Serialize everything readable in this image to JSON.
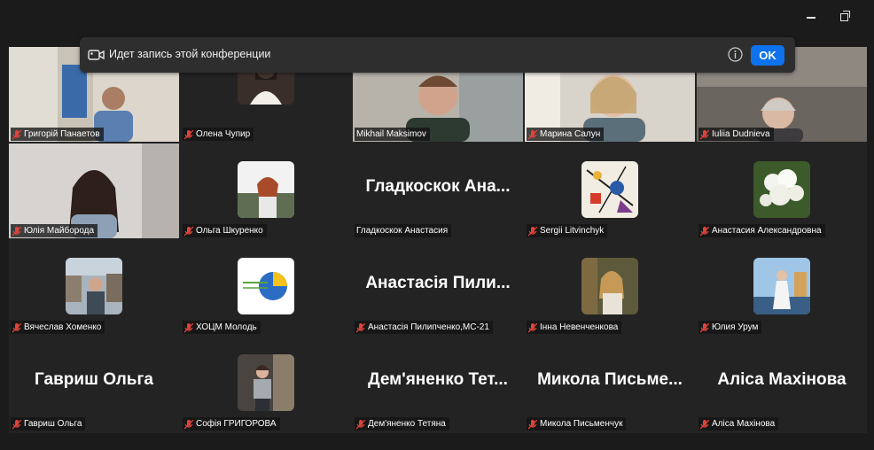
{
  "banner": {
    "text": "Идет запись этой конференции",
    "ok_label": "OK"
  },
  "window_controls": [
    "minimize-icon",
    "restore-icon"
  ],
  "participants": [
    {
      "name": "Григорій Панаетов",
      "muted": true
    },
    {
      "name": "Олена Чупир",
      "muted": true
    },
    {
      "name": "Mikhail Maksimov",
      "muted": false,
      "active_speaker": true
    },
    {
      "name": "Марина Салун",
      "muted": true
    },
    {
      "name": "Iuliia Dudnieva",
      "muted": true
    },
    {
      "name": "Юлія Майборода",
      "muted": true
    },
    {
      "name": "Ольга Шкуренко",
      "muted": true
    },
    {
      "name": "Гладкоскок Анастасия",
      "muted": false,
      "display_name": "Гладкоскок  Ана..."
    },
    {
      "name": "Sergii Litvinchyk",
      "muted": true
    },
    {
      "name": "Анастасия Александровна",
      "muted": true
    },
    {
      "name": "Вячеслав Хоменко",
      "muted": true
    },
    {
      "name": "ХОЦМ Молодь",
      "muted": true
    },
    {
      "name": "Анастасія Пилипченко,МС-21",
      "muted": true,
      "display_name": "Анастасія  Пили..."
    },
    {
      "name": "Інна Невенченкова",
      "muted": true
    },
    {
      "name": "Юлия Урум",
      "muted": true
    },
    {
      "name": "Гавриш Ольга",
      "muted": true,
      "display_name": "Гавриш Ольга"
    },
    {
      "name": "Софія ГРИГОРОВА",
      "muted": true
    },
    {
      "name": "Дем'яненко Тетяна",
      "muted": true,
      "display_name": "Дем'яненко  Тет..."
    },
    {
      "name": "Микола Письменчук",
      "muted": true,
      "display_name": "Микола  Письме..."
    },
    {
      "name": "Аліса Махінова",
      "muted": true,
      "display_name": "Аліса Махінова"
    }
  ],
  "colors": {
    "ok_button": "#0e72ed",
    "active_speaker_border": "#2fc67a",
    "mute_icon": "#e0433a"
  }
}
